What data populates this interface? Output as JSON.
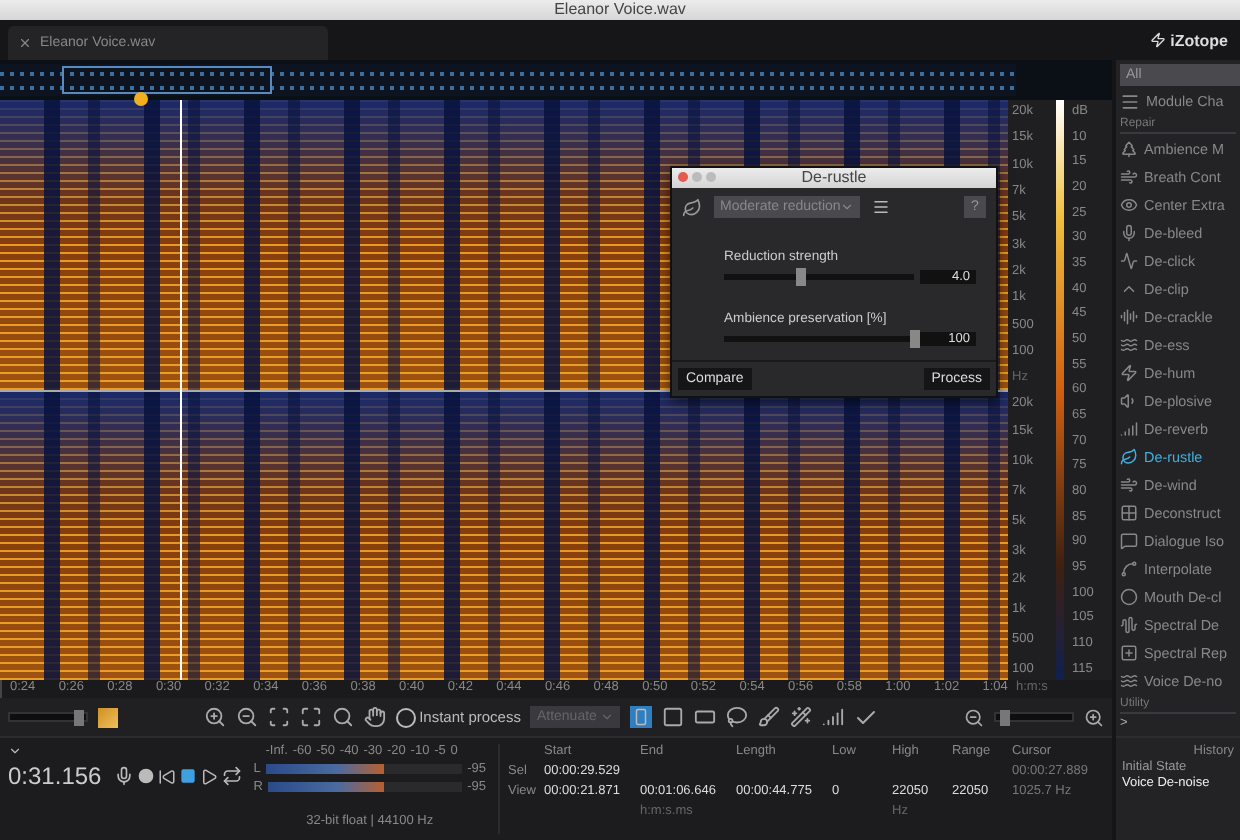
{
  "window": {
    "title": "Eleanor Voice.wav"
  },
  "tab": {
    "label": "Eleanor Voice.wav"
  },
  "brand": "iZotope",
  "frequency_scale": [
    [
      "20k",
      "15k",
      "10k",
      "7k",
      "5k",
      "3k",
      "2k",
      "1k",
      "500",
      "100"
    ],
    [
      "20k",
      "15k",
      "10k",
      "7k",
      "5k",
      "3k",
      "2k",
      "1k",
      "500",
      "100"
    ]
  ],
  "frequency_unit": "Hz",
  "db_scale": [
    "dB",
    "10",
    "15",
    "20",
    "25",
    "30",
    "35",
    "40",
    "45",
    "50",
    "55",
    "60",
    "65",
    "70",
    "75",
    "80",
    "85",
    "90",
    "95",
    "100",
    "105",
    "110",
    "115"
  ],
  "time_ruler": {
    "ticks": [
      "0:24",
      "0:26",
      "0:28",
      "0:30",
      "0:32",
      "0:34",
      "0:36",
      "0:38",
      "0:40",
      "0:42",
      "0:44",
      "0:46",
      "0:48",
      "0:50",
      "0:52",
      "0:54",
      "0:56",
      "0:58",
      "1:00",
      "1:02",
      "1:04"
    ],
    "unit": "h:m:s"
  },
  "dialog": {
    "title": "De-rustle",
    "preset": "Moderate reduction",
    "help": "?",
    "sliders": [
      {
        "label": "Reduction strength",
        "level": 0.4,
        "reading": "4.0"
      },
      {
        "label": "Ambience preservation [%]",
        "level": 1.0,
        "reading": "100"
      }
    ],
    "buttons": [
      "Compare",
      "Process"
    ]
  },
  "toolbar": {
    "instant_process": {
      "label": "Instant process",
      "on": false
    },
    "mode": "Attenuate",
    "zoom_sliders": [
      {
        "level": 0.9
      },
      {
        "level": 0.1
      }
    ]
  },
  "transport": {
    "time": "0:31.156"
  },
  "meter": {
    "scale": [
      "-Inf.",
      "-60",
      "-50",
      "-40",
      "-30",
      "-20",
      "-10",
      "-5",
      "0"
    ],
    "channels": [
      {
        "name": "L",
        "level": 0.6,
        "reading": "-95"
      },
      {
        "name": "R",
        "level": 0.6,
        "reading": "-95"
      }
    ],
    "format": "32-bit float | 44100 Hz"
  },
  "selection": {
    "columns": [
      "Start",
      "End",
      "Length",
      "Low",
      "High",
      "Range",
      "Cursor"
    ],
    "rows": [
      {
        "label": "Sel",
        "cells": [
          "00:00:29.529",
          "",
          "",
          "",
          "",
          ""
        ],
        "cursor": "00:00:27.889"
      },
      {
        "label": "View",
        "cells": [
          "00:00:21.871",
          "00:01:06.646",
          "00:00:44.775",
          "0",
          "22050",
          "22050"
        ],
        "cursor": "1025.7 Hz"
      }
    ],
    "time_unit": "h:m:s.ms",
    "freq_unit": "Hz"
  },
  "sidebar": {
    "filter": "All",
    "chain": "Module Cha",
    "repair_label": "Repair",
    "items": [
      {
        "label": "Ambience M",
        "selected": false
      },
      {
        "label": "Breath Cont",
        "selected": false
      },
      {
        "label": "Center Extra",
        "selected": false
      },
      {
        "label": "De-bleed",
        "selected": false
      },
      {
        "label": "De-click",
        "selected": false
      },
      {
        "label": "De-clip",
        "selected": false
      },
      {
        "label": "De-crackle",
        "selected": false
      },
      {
        "label": "De-ess",
        "selected": false
      },
      {
        "label": "De-hum",
        "selected": false
      },
      {
        "label": "De-plosive",
        "selected": false
      },
      {
        "label": "De-reverb",
        "selected": false
      },
      {
        "label": "De-rustle",
        "selected": true
      },
      {
        "label": "De-wind",
        "selected": false
      },
      {
        "label": "Deconstruct",
        "selected": false
      },
      {
        "label": "Dialogue Iso",
        "selected": false
      },
      {
        "label": "Interpolate",
        "selected": false
      },
      {
        "label": "Mouth De-cl",
        "selected": false
      },
      {
        "label": "Spectral De",
        "selected": false
      },
      {
        "label": "Spectral Rep",
        "selected": false
      },
      {
        "label": "Voice De-no",
        "selected": false
      }
    ],
    "utility_label": "Utility",
    "more": ">"
  },
  "history": {
    "title": "History",
    "items": [
      {
        "label": "Initial State",
        "selected": false
      },
      {
        "label": "Voice De-noise",
        "selected": true
      }
    ]
  }
}
